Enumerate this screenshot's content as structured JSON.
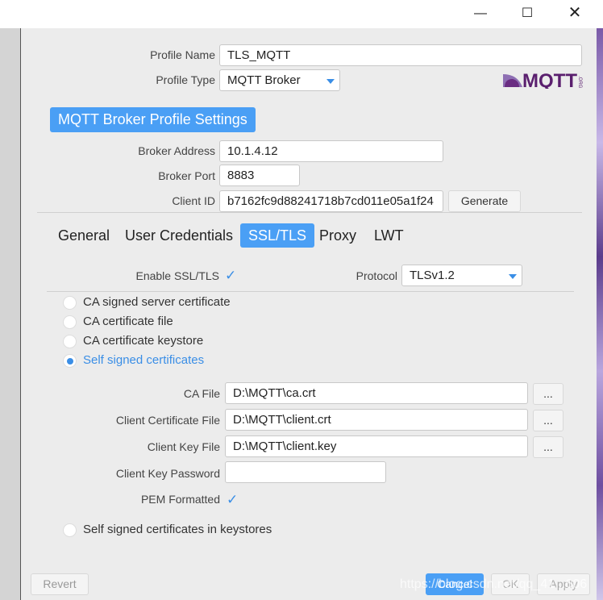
{
  "window": {
    "minimize_icon": "minimize-icon",
    "maximize_icon": "maximize-icon",
    "close_icon": "close-icon"
  },
  "profile": {
    "name_label": "Profile Name",
    "name_value": "TLS_MQTT",
    "type_label": "Profile Type",
    "type_value": "MQTT Broker",
    "logo_text": "MQTT",
    "logo_suffix": ".ORG"
  },
  "section_title": "MQTT Broker Profile Settings",
  "broker": {
    "address_label": "Broker Address",
    "address_value": "10.1.4.12",
    "port_label": "Broker Port",
    "port_value": "8883",
    "client_id_label": "Client ID",
    "client_id_value": "b7162fc9d88241718b7cd011e05a1f24",
    "generate_label": "Generate"
  },
  "tabs": [
    {
      "label": "General"
    },
    {
      "label": "User Credentials"
    },
    {
      "label": "SSL/TLS",
      "active": true
    },
    {
      "label": "Proxy"
    },
    {
      "label": "LWT"
    }
  ],
  "ssl": {
    "enable_label": "Enable SSL/TLS",
    "enable_checked": true,
    "protocol_label": "Protocol",
    "protocol_value": "TLSv1.2",
    "options": [
      {
        "label": "CA signed server certificate",
        "selected": false
      },
      {
        "label": "CA certificate file",
        "selected": false
      },
      {
        "label": "CA certificate keystore",
        "selected": false
      },
      {
        "label": "Self signed certificates",
        "selected": true
      }
    ],
    "ca_file_label": "CA File",
    "ca_file_value": "D:\\MQTT\\ca.crt",
    "client_cert_label": "Client Certificate File",
    "client_cert_value": "D:\\MQTT\\client.crt",
    "client_key_label": "Client Key File",
    "client_key_value": "D:\\MQTT\\client.key",
    "client_key_password_label": "Client Key Password",
    "client_key_password_value": "",
    "pem_label": "PEM Formatted",
    "pem_checked": true,
    "browse_label": "...",
    "keystores_label": "Self signed certificates in keystores"
  },
  "footer": {
    "revert": "Revert",
    "cancel": "Cancel",
    "ok": "OK",
    "apply": "Apply",
    "watermark": "https://blog.csdn.net/qq_41...606"
  },
  "colors": {
    "accent": "#4a9ff5",
    "background": "#ececec"
  }
}
